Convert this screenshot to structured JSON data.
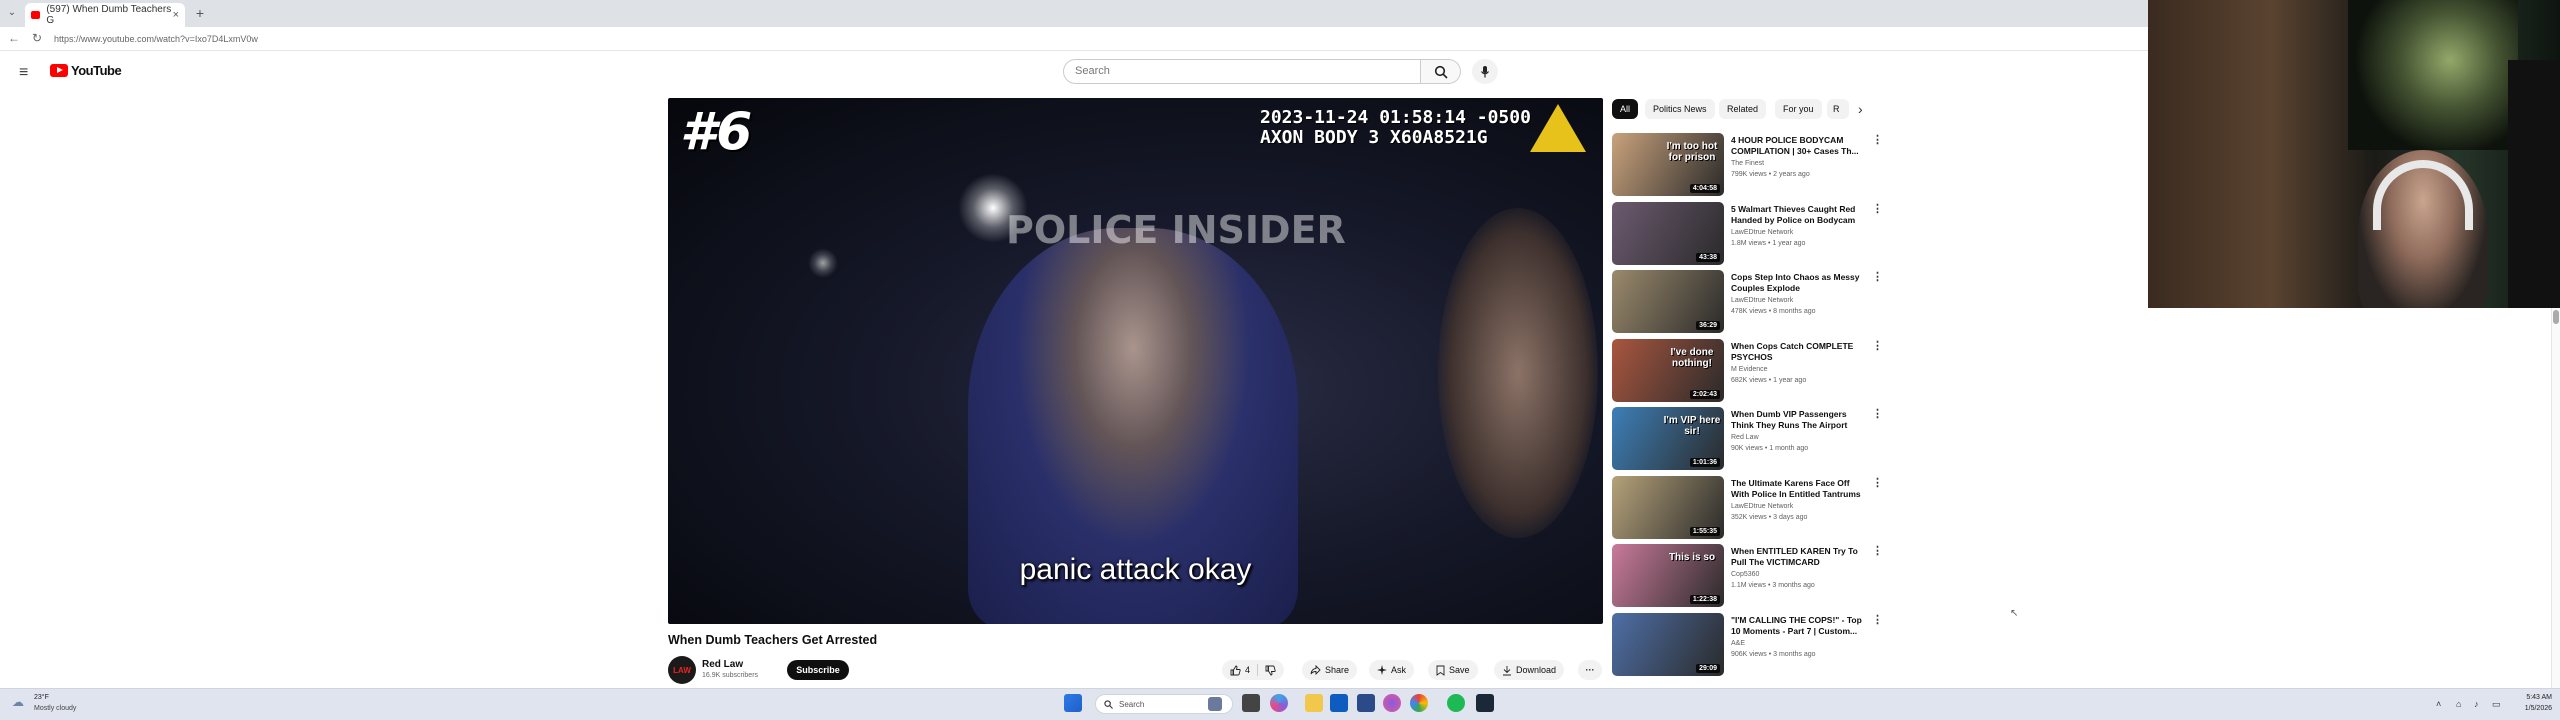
{
  "browser": {
    "tab_title": "(597) When Dumb Teachers G",
    "tab_close": "×",
    "tab_menu": "⌄",
    "new_tab": "+",
    "url": "https://www.youtube.com/watch?v=Ixo7D4LxmV0w",
    "nav": {
      "back": "←",
      "refresh": "↻"
    }
  },
  "youtube": {
    "logo_text": "YouTube",
    "menu_icon": "≡",
    "search_placeholder": "Search"
  },
  "player": {
    "episode": "#6",
    "timestamp_line1": "2023-11-24 01:58:14 -0500",
    "timestamp_line2": "AXON BODY 3 X60A8521G",
    "watermark": "POLICE INSIDER",
    "subtitle": "panic attack okay"
  },
  "video": {
    "title": "When Dumb Teachers Get Arrested",
    "channel": "Red Law",
    "avatar_text": "LAW",
    "subscribers": "16.9K subscribers",
    "subscribe_label": "Subscribe",
    "likes": "4",
    "share_label": "Share",
    "ask_label": "Ask",
    "save_label": "Save",
    "download_label": "Download",
    "more": "···"
  },
  "chips": [
    "All",
    "Politics News",
    "Related",
    "For you",
    "R"
  ],
  "recommendations": [
    {
      "title": "4 HOUR POLICE BODYCAM COMPILATION | 30+ Cases Th...",
      "channel": "The Finest",
      "meta": "799K views • 2 years ago",
      "duration": "4:04:58",
      "overlay": "I'm too hot for prison",
      "color": "#c9a27c"
    },
    {
      "title": "5 Walmart Thieves Caught Red Handed by Police on Bodycam",
      "channel": "LawEDtrue Network",
      "meta": "1.8M views • 1 year ago",
      "duration": "43:38",
      "overlay": "",
      "color": "#6c5a70"
    },
    {
      "title": "Cops Step Into Chaos as Messy Couples Explode",
      "channel": "LawEDtrue Network",
      "meta": "478K views • 8 months ago",
      "duration": "36:29",
      "overlay": "",
      "color": "#9b8a6c"
    },
    {
      "title": "When Cops Catch COMPLETE PSYCHOS",
      "channel": "M Evidence",
      "meta": "682K views • 1 year ago",
      "duration": "2:02:43",
      "overlay": "I've done nothing!",
      "color": "#a9563f"
    },
    {
      "title": "When Dumb VIP Passengers Think They Runs The Airport",
      "channel": "Red Law",
      "meta": "90K views • 1 month ago",
      "duration": "1:01:36",
      "overlay": "I'm VIP here sir!",
      "color": "#3d7fb7"
    },
    {
      "title": "The Ultimate Karens Face Off With Police In Entitled Tantrums",
      "channel": "LawEDtrue Network",
      "meta": "352K views • 3 days ago",
      "duration": "1:55:35",
      "overlay": "",
      "color": "#b5a27a"
    },
    {
      "title": "When ENTITLED KAREN Try To Pull The VICTIMCARD",
      "channel": "Cop5360",
      "meta": "1.1M views • 3 months ago",
      "duration": "1:22:38",
      "overlay": "This is so",
      "color": "#c97a9a"
    },
    {
      "title": "\"I'M CALLING THE COPS!\" - Top 10 Moments - Part 7 | Custom...",
      "channel": "A&E",
      "meta": "906K views • 3 months ago",
      "duration": "29:09",
      "overlay": "",
      "color": "#4e6fa6"
    }
  ],
  "taskbar": {
    "weather_temp": "23°F",
    "weather_desc": "Mostly cloudy",
    "search_label": "Search",
    "time": "5:43 AM",
    "date": "1/5/2026"
  }
}
